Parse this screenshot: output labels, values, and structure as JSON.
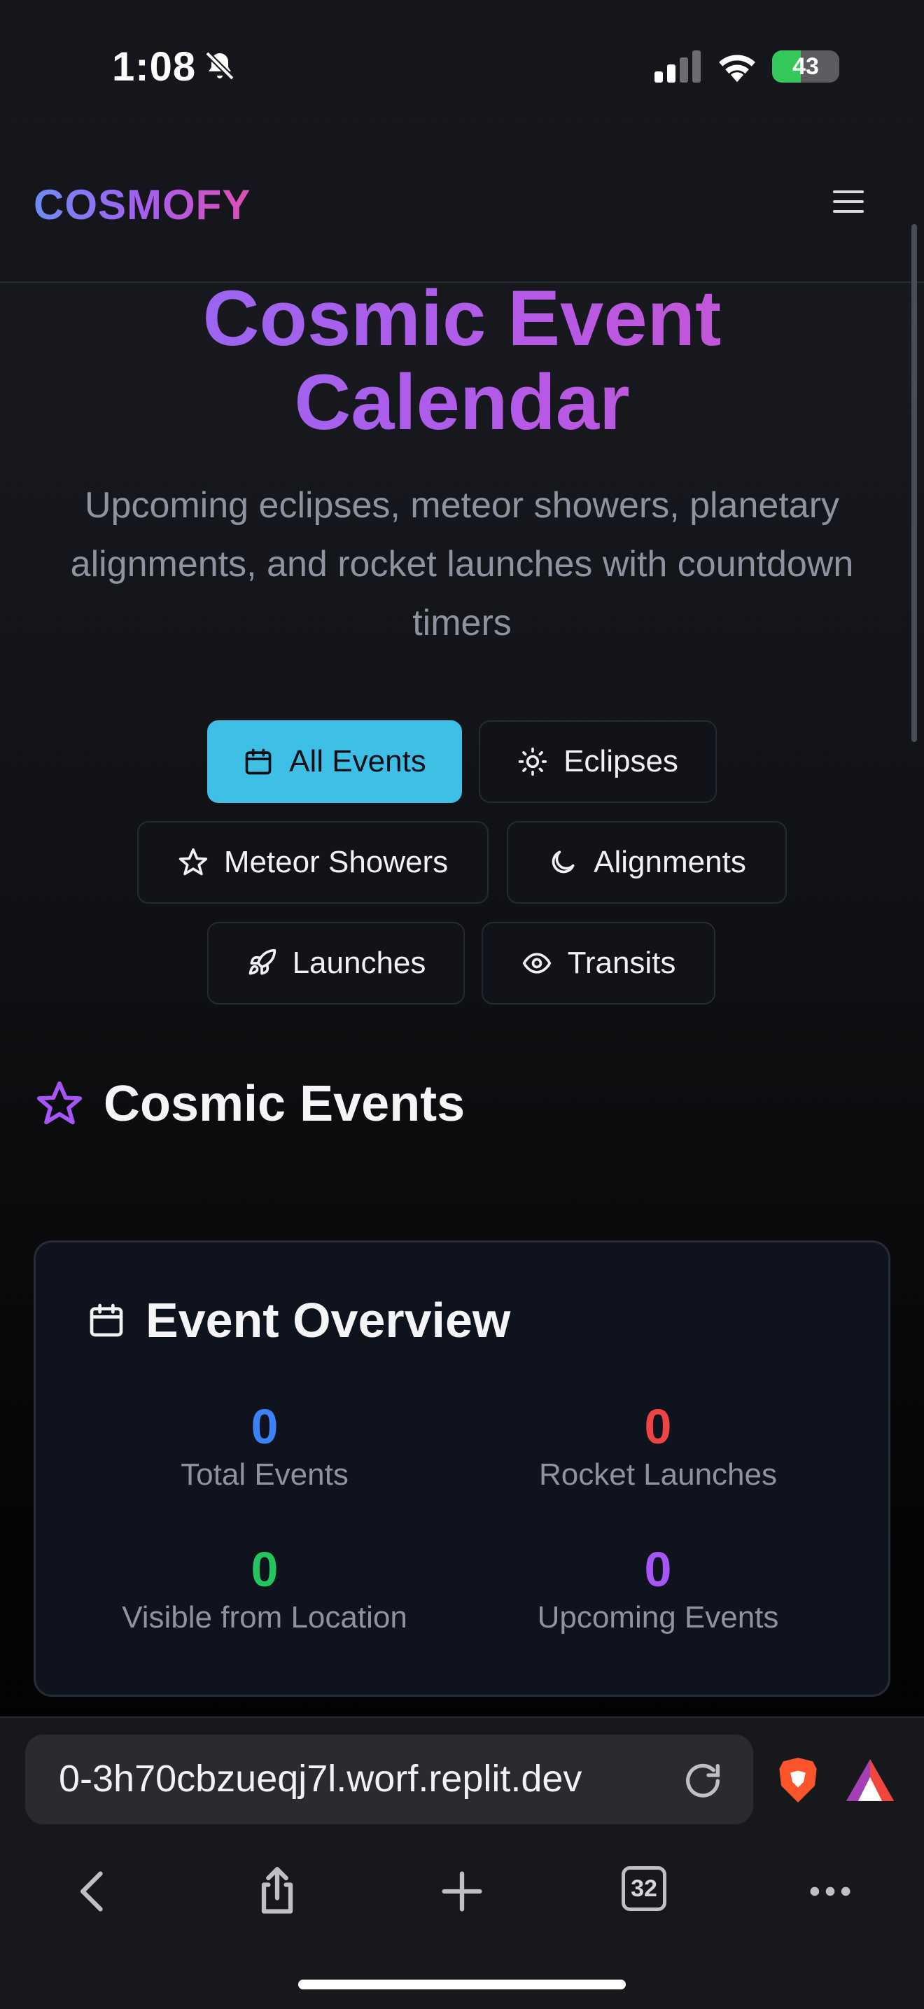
{
  "status_bar": {
    "time": "1:08",
    "battery": "43"
  },
  "header": {
    "logo": "COSMOFY"
  },
  "hero": {
    "title_line1": "Cosmic Event",
    "title_line2": "Calendar",
    "subtitle": "Upcoming eclipses, meteor showers, planetary alignments, and rocket launches with countdown timers"
  },
  "filters": [
    {
      "label": "All Events",
      "icon": "calendar-icon",
      "active": true
    },
    {
      "label": "Eclipses",
      "icon": "sun-icon",
      "active": false
    },
    {
      "label": "Meteor Showers",
      "icon": "star-icon",
      "active": false
    },
    {
      "label": "Alignments",
      "icon": "moon-icon",
      "active": false
    },
    {
      "label": "Launches",
      "icon": "rocket-icon",
      "active": false
    },
    {
      "label": "Transits",
      "icon": "eye-icon",
      "active": false
    }
  ],
  "section": {
    "title": "Cosmic Events"
  },
  "overview": {
    "title": "Event Overview",
    "stats": [
      {
        "value": "0",
        "label": "Total Events",
        "color": "#3b82f6"
      },
      {
        "value": "0",
        "label": "Rocket Launches",
        "color": "#ef4444"
      },
      {
        "value": "0",
        "label": "Visible from Location",
        "color": "#22c55e"
      },
      {
        "value": "0",
        "label": "Upcoming Events",
        "color": "#a855f7"
      }
    ]
  },
  "browser": {
    "url": "0-3h70cbzueqj7l.worf.replit.dev",
    "tab_count": "32"
  },
  "colors": {
    "accent": "#3dbfe6",
    "brand_start": "#6d8df5",
    "brand_end": "#e04fb4"
  }
}
